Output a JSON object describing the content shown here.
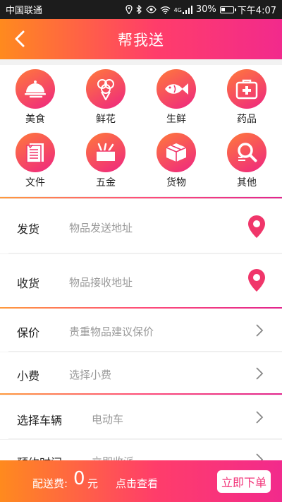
{
  "status_bar": {
    "carrier": "中国联通",
    "signal_tag": "4G",
    "battery": "30%",
    "time": "下午4:07"
  },
  "header": {
    "title": "帮我送"
  },
  "categories": [
    {
      "label": "美食",
      "icon": "cloche-icon"
    },
    {
      "label": "鲜花",
      "icon": "flower-icon"
    },
    {
      "label": "生鲜",
      "icon": "fish-icon"
    },
    {
      "label": "药品",
      "icon": "medkit-icon"
    },
    {
      "label": "文件",
      "icon": "document-icon"
    },
    {
      "label": "五金",
      "icon": "tools-icon"
    },
    {
      "label": "货物",
      "icon": "box-icon"
    },
    {
      "label": "其他",
      "icon": "magnifier-icon"
    }
  ],
  "address": {
    "send": {
      "label": "发货",
      "placeholder": "物品发送地址"
    },
    "receive": {
      "label": "收货",
      "placeholder": "物品接收地址"
    }
  },
  "options": {
    "insurance": {
      "label": "保价",
      "value": "贵重物品建议保价"
    },
    "tip": {
      "label": "小费",
      "value": "选择小费"
    },
    "vehicle": {
      "label": "选择车辆",
      "value": "电动车"
    },
    "schedule": {
      "label": "预约时间",
      "value": "立即收派"
    }
  },
  "footer": {
    "fee_label": "配送费:",
    "fee_amount": "0",
    "fee_unit": "元",
    "view_link": "点击查看",
    "order_button": "立即下单"
  },
  "colors": {
    "gradient_start": "#ff8a1e",
    "gradient_mid": "#ff3d6a",
    "gradient_end": "#f22a8c",
    "pin": "#f0366a"
  }
}
